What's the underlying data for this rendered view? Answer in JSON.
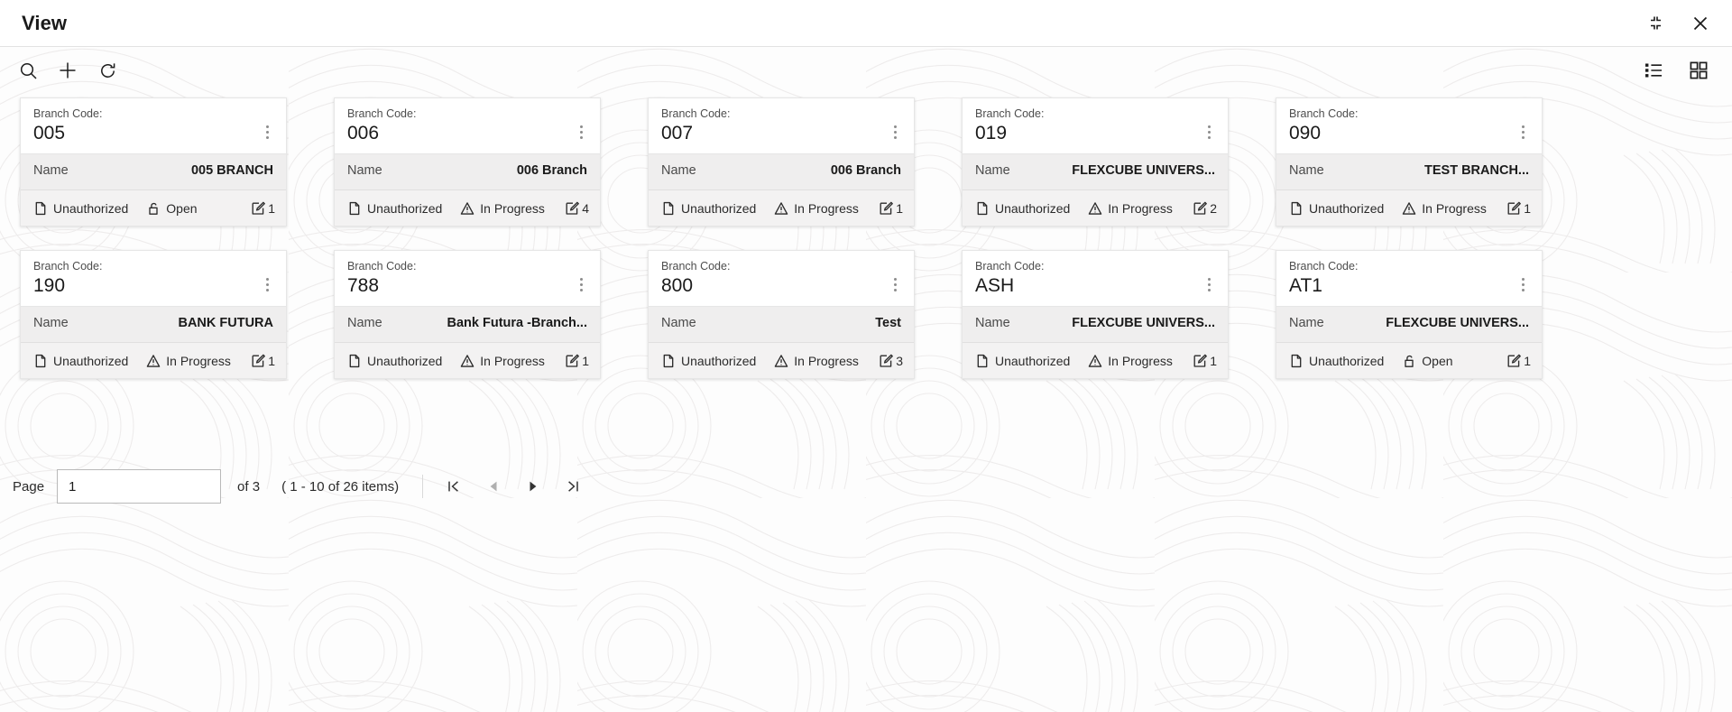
{
  "window": {
    "title": "View",
    "restore_icon": "collapse-icon",
    "close_icon": "close-icon"
  },
  "toolbar": {
    "search_icon": "search-icon",
    "add_icon": "plus-icon",
    "refresh_icon": "refresh-icon",
    "list_view_icon": "list-view-icon",
    "grid_view_icon": "grid-view-icon"
  },
  "card_fields": {
    "code_label": "Branch Code:",
    "name_label": "Name",
    "menu_icon": "kebab-menu-icon",
    "auth_icon": "document-icon",
    "open_icon": "unlock-icon",
    "in_progress_icon": "warning-triangle-icon",
    "count_icon": "edit-square-icon"
  },
  "cards": [
    {
      "code": "005",
      "name": "005 BRANCH",
      "auth": "Unauthorized",
      "status": "Open",
      "status_icon": "unlock-icon",
      "count": "1"
    },
    {
      "code": "006",
      "name": "006 Branch",
      "auth": "Unauthorized",
      "status": "In Progress",
      "status_icon": "warning-triangle-icon",
      "count": "4"
    },
    {
      "code": "007",
      "name": "006 Branch",
      "auth": "Unauthorized",
      "status": "In Progress",
      "status_icon": "warning-triangle-icon",
      "count": "1"
    },
    {
      "code": "019",
      "name": "FLEXCUBE UNIVERS...",
      "auth": "Unauthorized",
      "status": "In Progress",
      "status_icon": "warning-triangle-icon",
      "count": "2"
    },
    {
      "code": "090",
      "name": "TEST BRANCH...",
      "auth": "Unauthorized",
      "status": "In Progress",
      "status_icon": "warning-triangle-icon",
      "count": "1"
    },
    {
      "code": "190",
      "name": "BANK FUTURA",
      "auth": "Unauthorized",
      "status": "In Progress",
      "status_icon": "warning-triangle-icon",
      "count": "1"
    },
    {
      "code": "788",
      "name": "Bank Futura -Branch...",
      "auth": "Unauthorized",
      "status": "In Progress",
      "status_icon": "warning-triangle-icon",
      "count": "1"
    },
    {
      "code": "800",
      "name": "Test",
      "auth": "Unauthorized",
      "status": "In Progress",
      "status_icon": "warning-triangle-icon",
      "count": "3"
    },
    {
      "code": "ASH",
      "name": "FLEXCUBE UNIVERS...",
      "auth": "Unauthorized",
      "status": "In Progress",
      "status_icon": "warning-triangle-icon",
      "count": "1"
    },
    {
      "code": "AT1",
      "name": "FLEXCUBE UNIVERS...",
      "auth": "Unauthorized",
      "status": "Open",
      "status_icon": "unlock-icon",
      "count": "1"
    }
  ],
  "pagination": {
    "page_label": "Page",
    "page_value": "1",
    "of_text": "of 3",
    "items_text": "( 1 - 10 of 26 items)",
    "first_icon": "first-page-icon",
    "prev_icon": "prev-page-icon",
    "next_icon": "next-page-icon",
    "last_icon": "last-page-icon"
  }
}
